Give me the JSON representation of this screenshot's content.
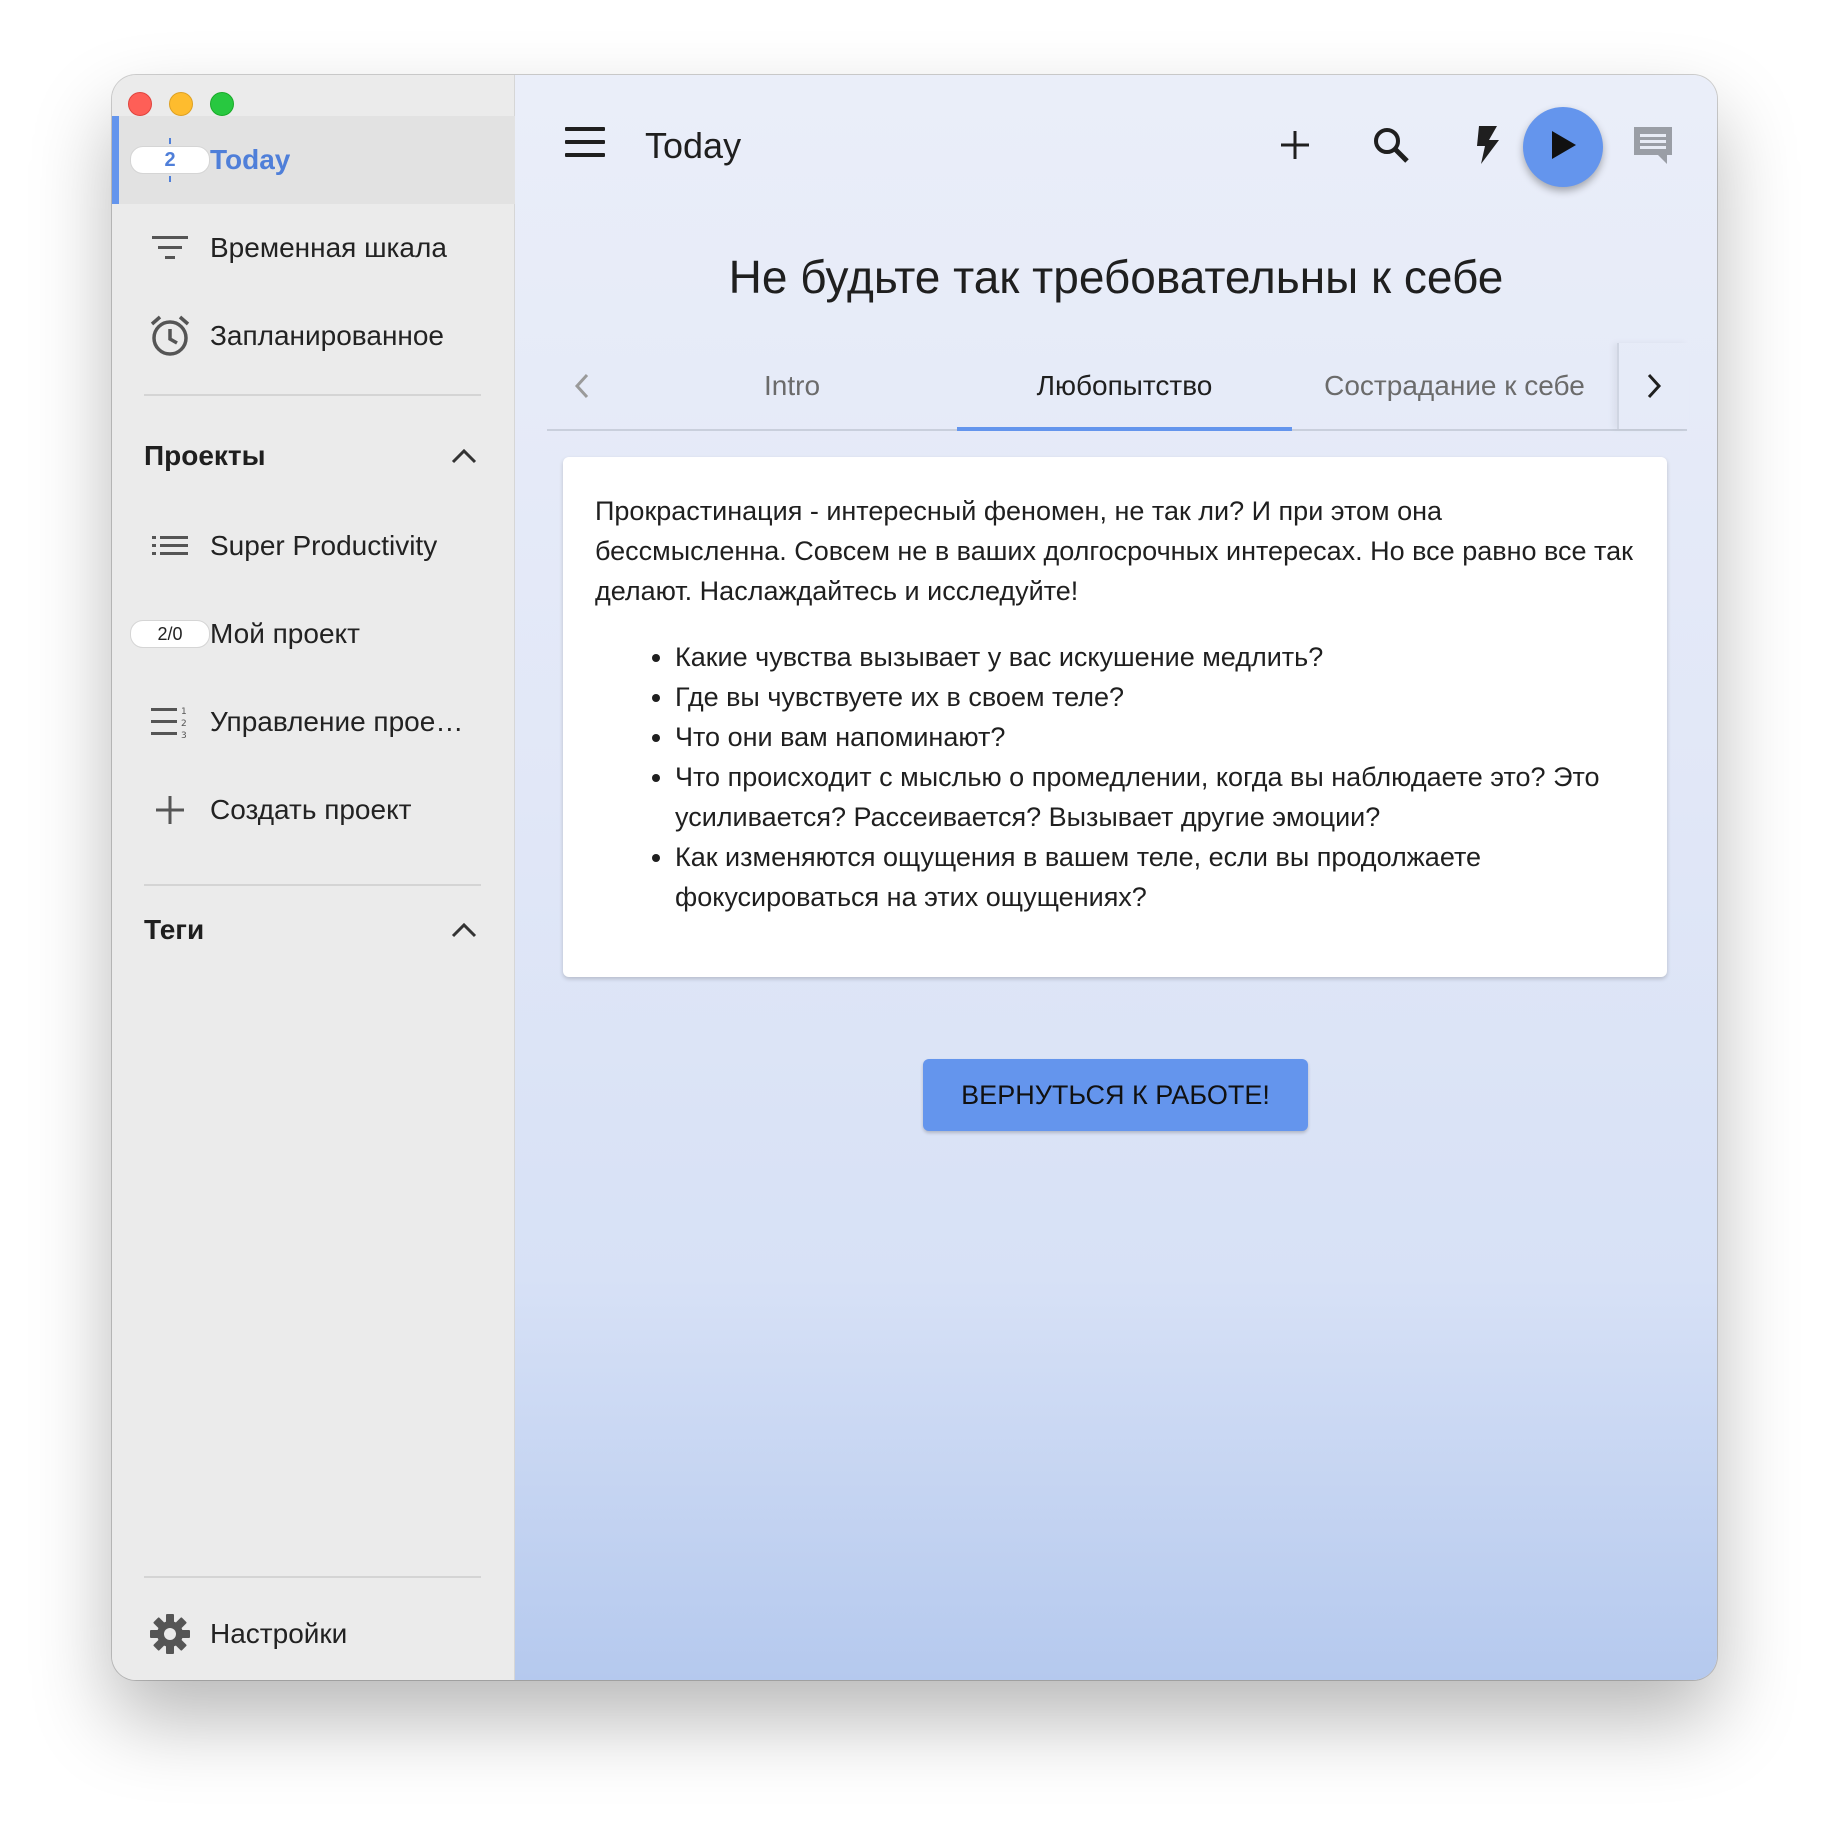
{
  "sidebar": {
    "today": {
      "label": "Today",
      "badge": "2"
    },
    "items": [
      {
        "label": "Временная шкала"
      },
      {
        "label": "Запланированное"
      }
    ],
    "projects": {
      "title": "Проекты",
      "items": [
        {
          "label": "Super Productivity"
        },
        {
          "label": "Мой проект",
          "badge": "2/0"
        },
        {
          "label": "Управление прое…"
        },
        {
          "label": "Создать проект"
        }
      ]
    },
    "tags": {
      "title": "Теги"
    },
    "settings": {
      "label": "Настройки"
    }
  },
  "topbar": {
    "title": "Today"
  },
  "main": {
    "headline": "Не будьте так требовательны к себе",
    "tabs": [
      {
        "label": "Intro"
      },
      {
        "label": "Любопытство"
      },
      {
        "label": "Сострадание к себе"
      }
    ],
    "active_tab": "Любопытство",
    "card": {
      "intro": "Прокрастинация - интересный феномен, не так ли? И при этом она бессмысленна. Совсем не в ваших долгосрочных интересах. Но все равно все так делают. Наслаждайтесь и исследуйте!",
      "bullets": [
        "Какие чувства вызывает у вас искушение медлить?",
        "Где вы чувствуете их в своем теле?",
        "Что они вам напоминают?",
        "Что происходит с мыслью о промедлении, когда вы наблюдаете это? Это усиливается? Рассеивается? Вызывает другие эмоции?",
        "Как изменяются ощущения в вашем теле, если вы продолжаете фокусироваться на этих ощущениях?"
      ]
    },
    "back_button": "ВЕРНУТЬСЯ К РАБОТЕ!"
  },
  "colors": {
    "accent": "#6495ed",
    "sidebar_bg": "#ebebeb",
    "active_text": "#4f7fd9"
  },
  "icons": [
    "menu-icon",
    "add-icon",
    "search-icon",
    "flash-icon",
    "play-icon",
    "chat-icon",
    "filter-list-icon",
    "alarm-icon",
    "list-icon",
    "numbered-list-icon",
    "plus-icon",
    "gear-icon",
    "chevron-up-icon",
    "chevron-left-icon",
    "chevron-right-icon"
  ]
}
